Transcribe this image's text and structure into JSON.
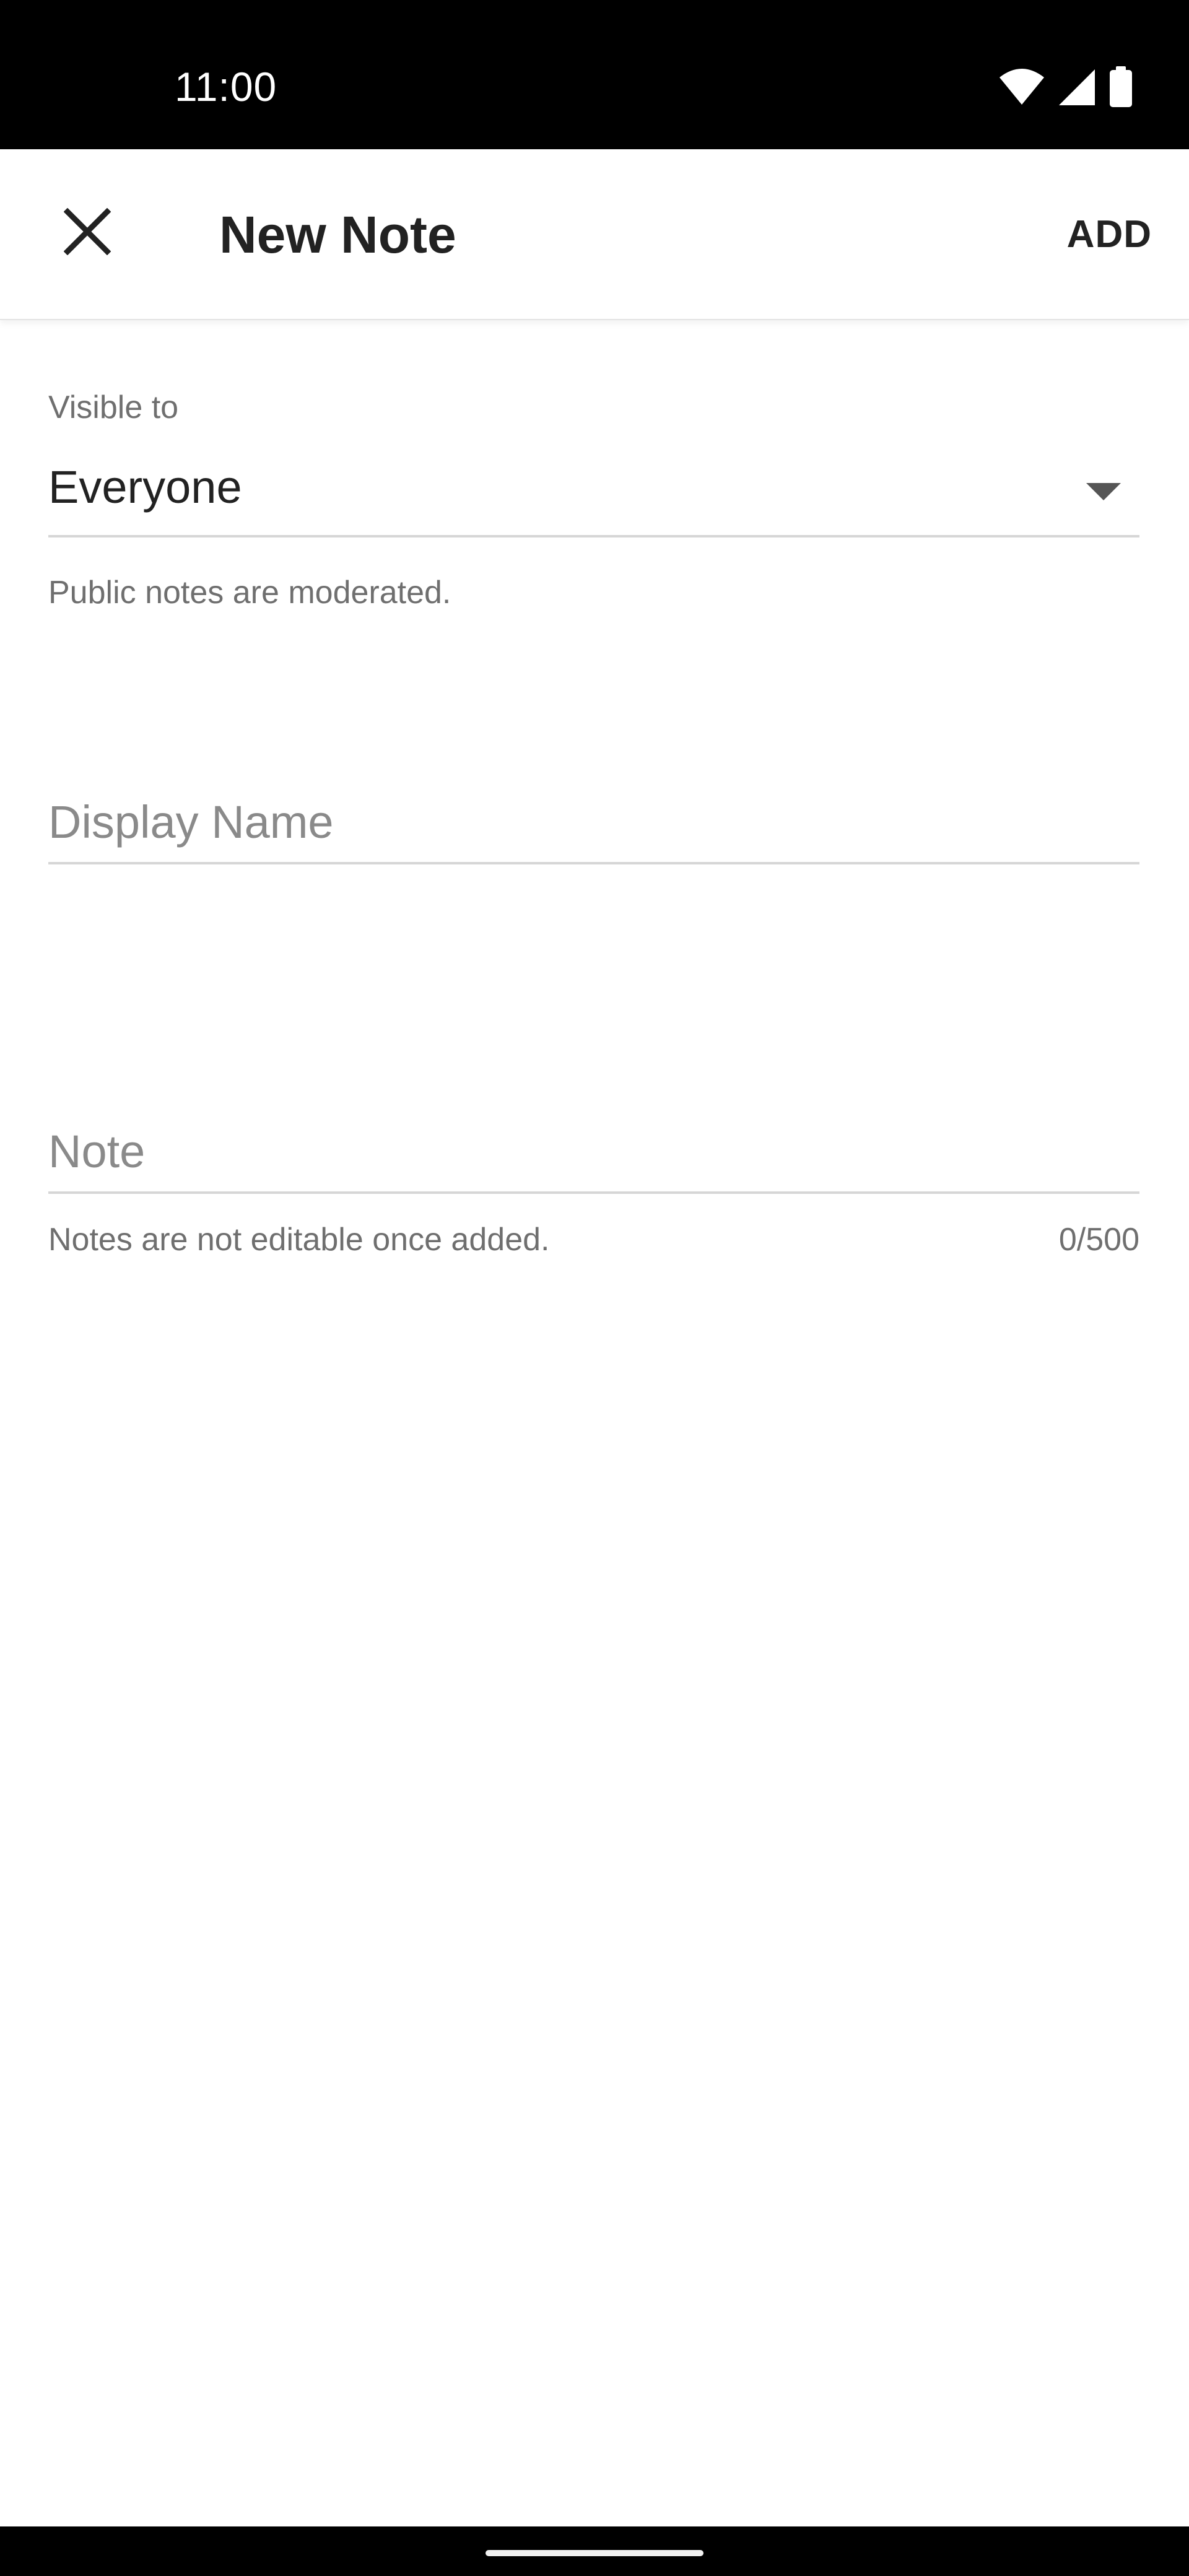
{
  "status_bar": {
    "time": "11:00",
    "icons": [
      "wifi-icon",
      "cellular-signal-icon",
      "battery-icon"
    ]
  },
  "app_bar": {
    "title": "New Note",
    "close_icon": "close-icon",
    "add_label": "ADD"
  },
  "visibility": {
    "label": "Visible to",
    "value": "Everyone",
    "helper": "Public notes are moderated."
  },
  "display_name": {
    "placeholder": "Display Name",
    "value": ""
  },
  "note": {
    "placeholder": "Note",
    "value": "",
    "helper": "Notes are not editable once added.",
    "counter": "0/500"
  },
  "colors": {
    "status_bar": "#000000",
    "text_primary": "#222222",
    "text_secondary": "#6f6f6f",
    "divider": "#d6d6d6"
  }
}
